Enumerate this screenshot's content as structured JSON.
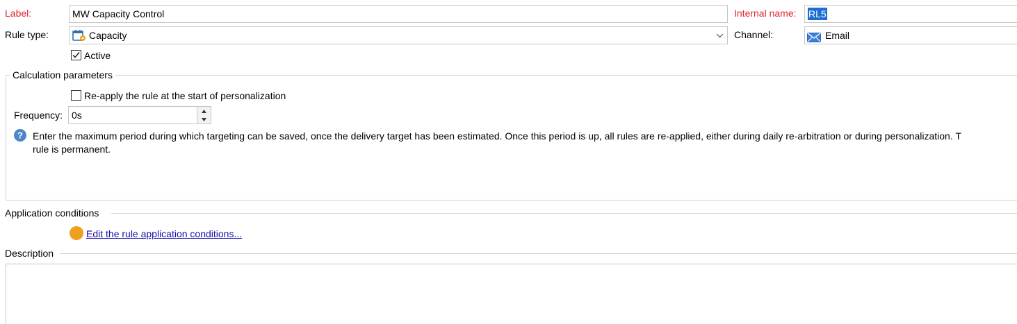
{
  "general": {
    "label_caption": "Label:",
    "label_value": "MW Capacity Control",
    "internal_name_caption": "Internal name:",
    "internal_name_value": "RL5",
    "rule_type_caption": "Rule type:",
    "rule_type_value": "Capacity",
    "channel_caption": "Channel:",
    "channel_value": "Email",
    "active_label": "Active",
    "active_checked": true
  },
  "calculation": {
    "group_title": "Calculation parameters",
    "reapply_label": "Re-apply the rule at the start of personalization",
    "reapply_checked": false,
    "frequency_caption": "Frequency:",
    "frequency_value": "0s",
    "help_text_line1": "Enter the maximum period during which targeting can be saved, once the delivery target has been estimated. Once this period is up, all rules are re-applied, either during daily re-arbitration or during personalization. T",
    "help_text_line2": "rule is permanent."
  },
  "application": {
    "group_title": "Application conditions",
    "edit_link": "Edit the rule application conditions..."
  },
  "description": {
    "group_title": "Description",
    "value": ""
  },
  "colors": {
    "required_label": "#e0262b",
    "selection": "#1a6fd0",
    "status_dot": "#f0a020",
    "link": "#1a0dab"
  },
  "icons": {
    "rule_type": "capacity-calendar-icon",
    "channel": "email-envelope-icon",
    "help": "help-question-icon",
    "status": "orange-dot-icon",
    "combo": "chevron-down-icon"
  }
}
